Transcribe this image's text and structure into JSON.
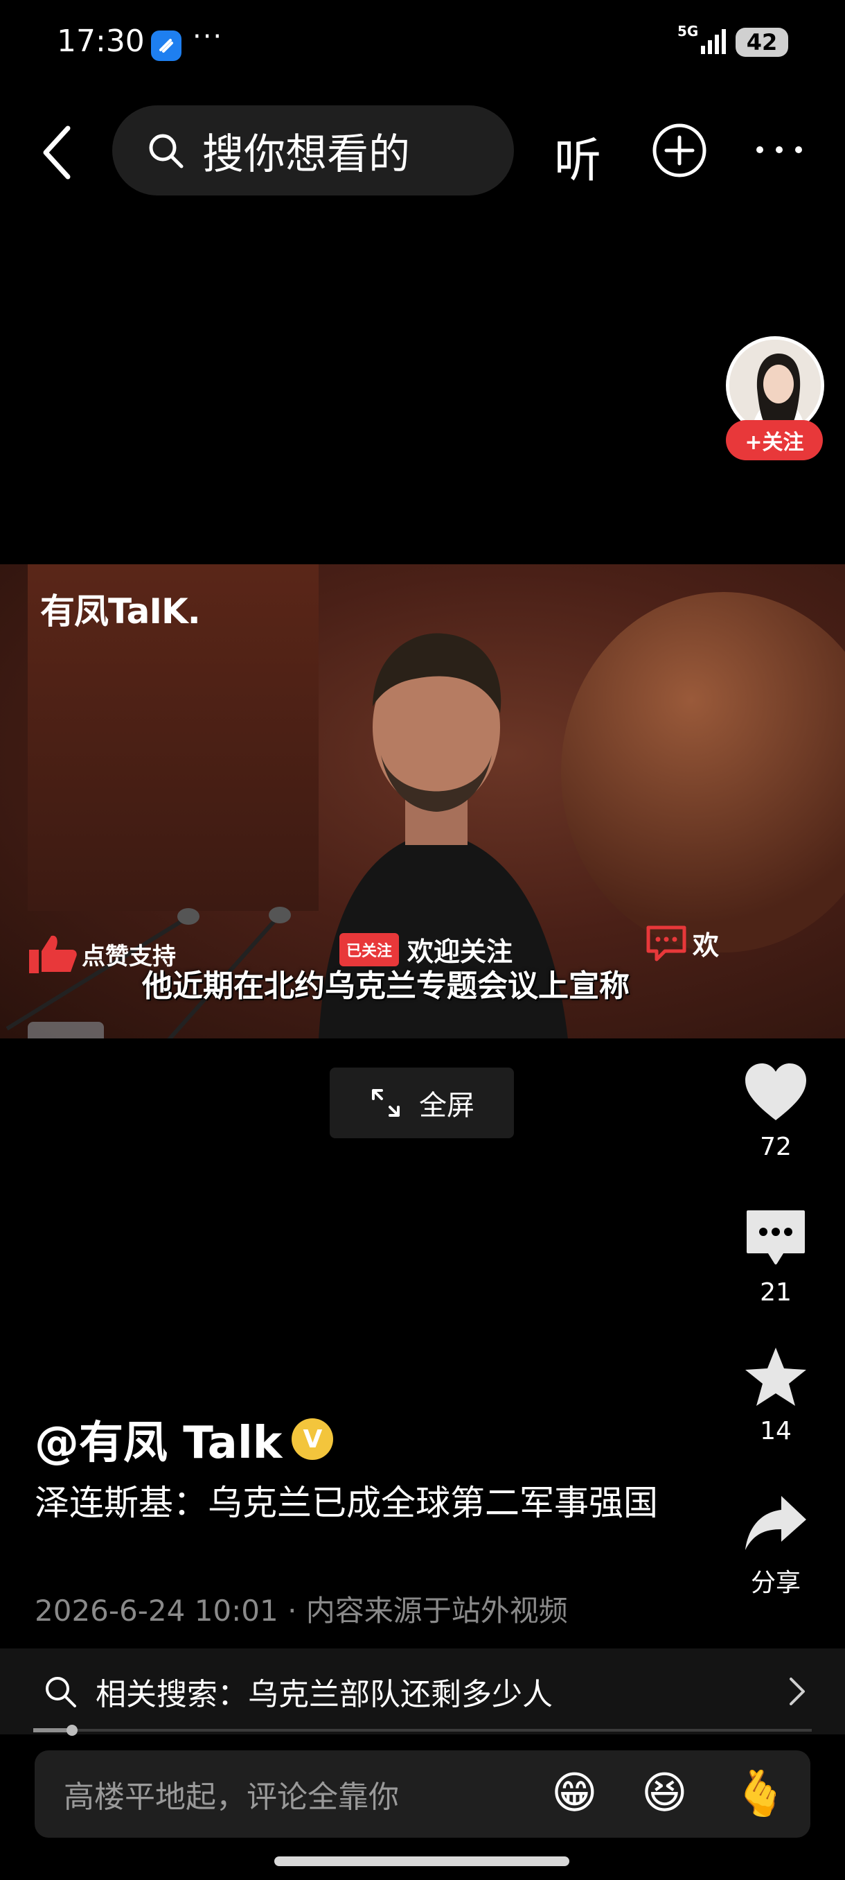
{
  "status_bar": {
    "time": "17:30",
    "dots": "···",
    "network": "5G",
    "battery": "42"
  },
  "nav": {
    "search_placeholder": "搜你想看的",
    "listen_label": "听"
  },
  "video": {
    "logo": "有凤TaIK.",
    "overlay_like": "点赞支持",
    "followed_tag": "已关注",
    "overlay_follow": "欢迎关注",
    "overlay_welcome": "欢",
    "subtitle": "他近期在北约乌克兰专题会议上宣称",
    "follow_button": "+关注"
  },
  "fullscreen_label": "全屏",
  "rail": {
    "likes": "72",
    "comments": "21",
    "favorites": "14",
    "share": "分享"
  },
  "post": {
    "author": "@有凤 Talk",
    "verified_mark": "V",
    "title": "泽连斯基：乌克兰已成全球第二军事强国",
    "meta": "2026-6-24 10:01 · 内容来源于站外视频"
  },
  "related_search": "相关搜索：乌克兰部队还剩多少人",
  "comment": {
    "placeholder": "高楼平地起，评论全靠你",
    "emoji_1": "😁",
    "emoji_2": "😆",
    "emoji_3": "🫰"
  }
}
